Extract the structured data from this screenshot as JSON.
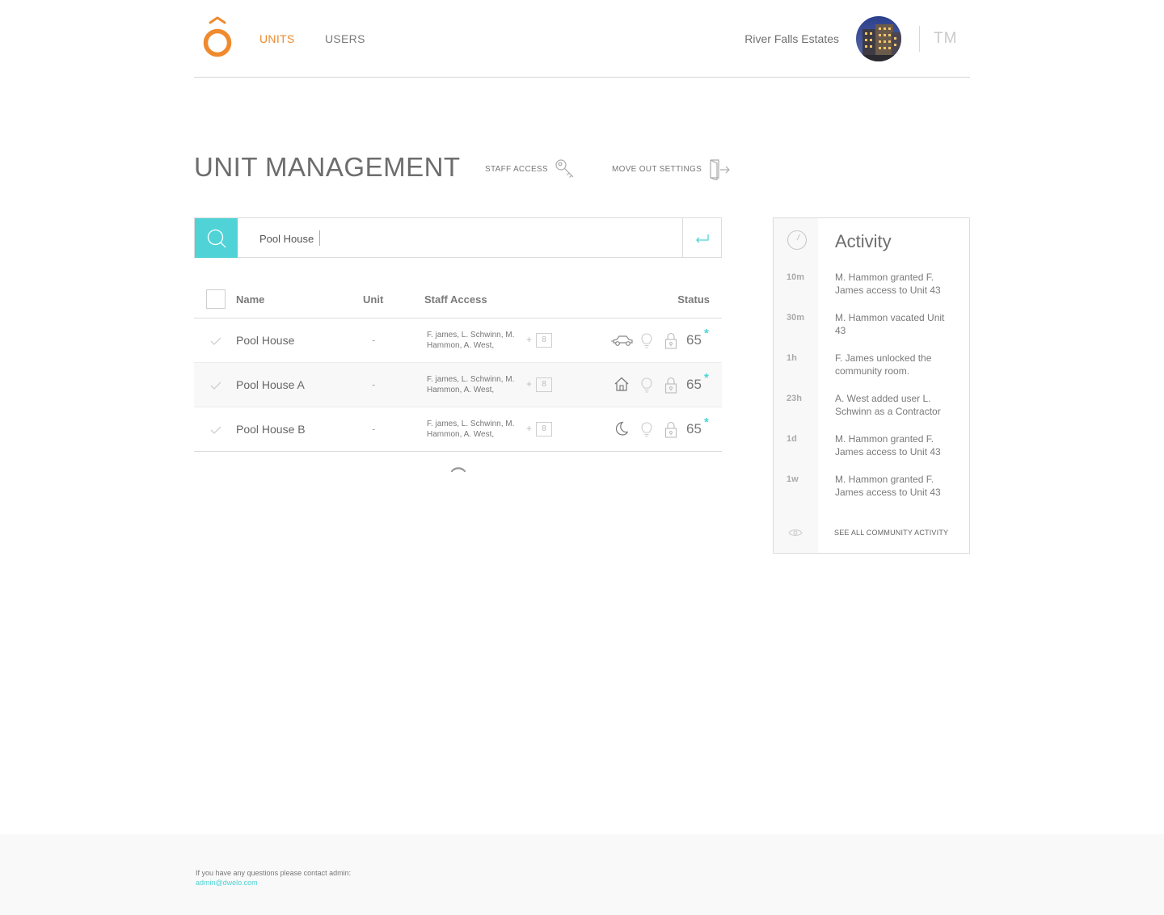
{
  "header": {
    "nav": [
      {
        "label": "UNITS",
        "active": true
      },
      {
        "label": "USERS",
        "active": false
      }
    ],
    "property_name": "River Falls Estates",
    "user_initials": "TM"
  },
  "page": {
    "title": "UNIT MANAGEMENT",
    "staff_access_label": "STAFF ACCESS",
    "move_out_label": "MOVE OUT SETTINGS"
  },
  "search": {
    "value": "Pool House"
  },
  "table": {
    "columns": [
      "Name",
      "Unit",
      "Staff Access",
      "Status"
    ],
    "rows": [
      {
        "name": "Pool House",
        "unit": "-",
        "staff": "F. james, L. Schwinn, M. Hammon, A. West,",
        "plus": "+",
        "extra_count": "8",
        "mode_icon": "car-icon",
        "temperature": "65",
        "temp_marker": "*"
      },
      {
        "name": "Pool House A",
        "unit": "-",
        "staff": "F. james, L. Schwinn, M. Hammon, A. West,",
        "plus": "+",
        "extra_count": "8",
        "mode_icon": "home-icon",
        "temperature": "65",
        "temp_marker": "*"
      },
      {
        "name": "Pool House B",
        "unit": "-",
        "staff": "F. james, L. Schwinn, M. Hammon, A. West,",
        "plus": "+",
        "extra_count": "8",
        "mode_icon": "moon-icon",
        "temperature": "65",
        "temp_marker": "*"
      }
    ]
  },
  "activity": {
    "title": "Activity",
    "items": [
      {
        "time": "10m",
        "text": "M. Hammon granted F. James access to Unit 43"
      },
      {
        "time": "30m",
        "text": "M. Hammon vacated Unit 43"
      },
      {
        "time": "1h",
        "text": "F. James unlocked the community room."
      },
      {
        "time": "23h",
        "text": "A. West added user L. Schwinn as a Contractor"
      },
      {
        "time": "1d",
        "text": "M. Hammon granted F. James access to Unit 43"
      },
      {
        "time": "1w",
        "text": "M. Hammon granted F. James access to Unit 43"
      }
    ],
    "see_all_label": "SEE ALL COMMUNITY ACTIVITY"
  },
  "footer": {
    "text": "If you have any questions please contact admin:",
    "email": "admin@dwelo.com"
  },
  "colors": {
    "accent": "#4fd3d6",
    "brand": "#ef8a2e"
  }
}
